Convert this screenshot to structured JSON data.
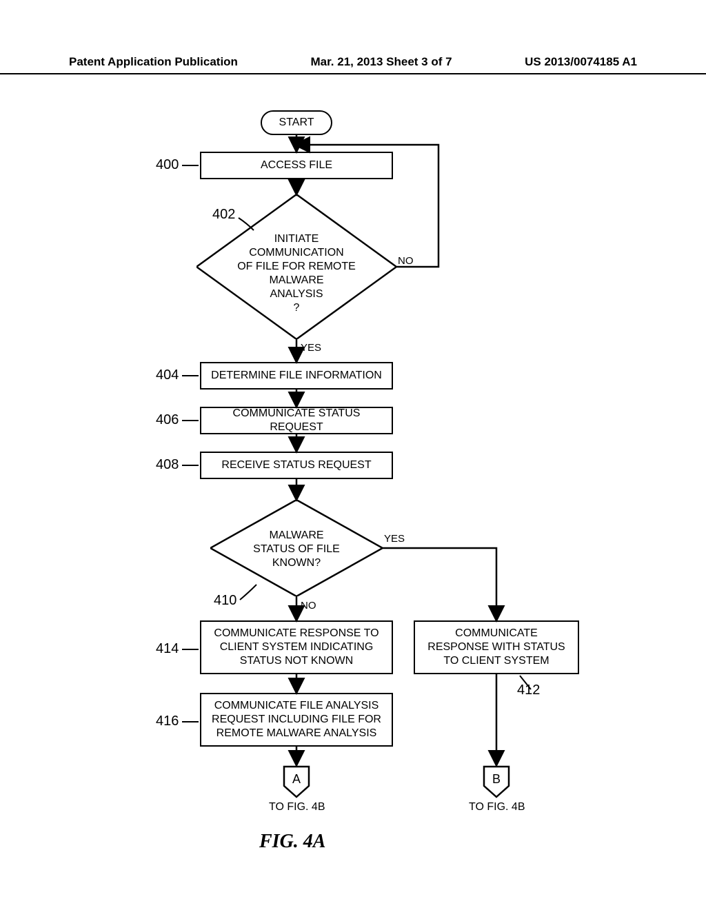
{
  "header": {
    "left": "Patent Application Publication",
    "center": "Mar. 21, 2013  Sheet 3 of 7",
    "right": "US 2013/0074185 A1"
  },
  "nodes": {
    "start": "START",
    "n400": "ACCESS FILE",
    "d402": "INITIATE\nCOMMUNICATION\nOF FILE FOR REMOTE\nMALWARE\nANALYSIS\n?",
    "n404": "DETERMINE FILE INFORMATION",
    "n406": "COMMUNICATE STATUS REQUEST",
    "n408": "RECEIVE STATUS REQUEST",
    "d410": "MALWARE\nSTATUS OF FILE\nKNOWN?",
    "n414": "COMMUNICATE RESPONSE TO\nCLIENT SYSTEM INDICATING\nSTATUS NOT KNOWN",
    "n412": "COMMUNICATE\nRESPONSE WITH STATUS\nTO CLIENT SYSTEM",
    "n416": "COMMUNICATE FILE ANALYSIS\nREQUEST INCLUDING FILE FOR\nREMOTE MALWARE ANALYSIS",
    "connA": "A",
    "connB": "B",
    "toA": "TO FIG. 4B",
    "toB": "TO FIG. 4B"
  },
  "refs": {
    "r400": "400",
    "r402": "402",
    "r404": "404",
    "r406": "406",
    "r408": "408",
    "r410": "410",
    "r412": "412",
    "r414": "414",
    "r416": "416"
  },
  "branches": {
    "yes1": "YES",
    "no1": "NO",
    "yes2": "YES",
    "no2": "NO"
  },
  "figure": "FIG. 4A"
}
